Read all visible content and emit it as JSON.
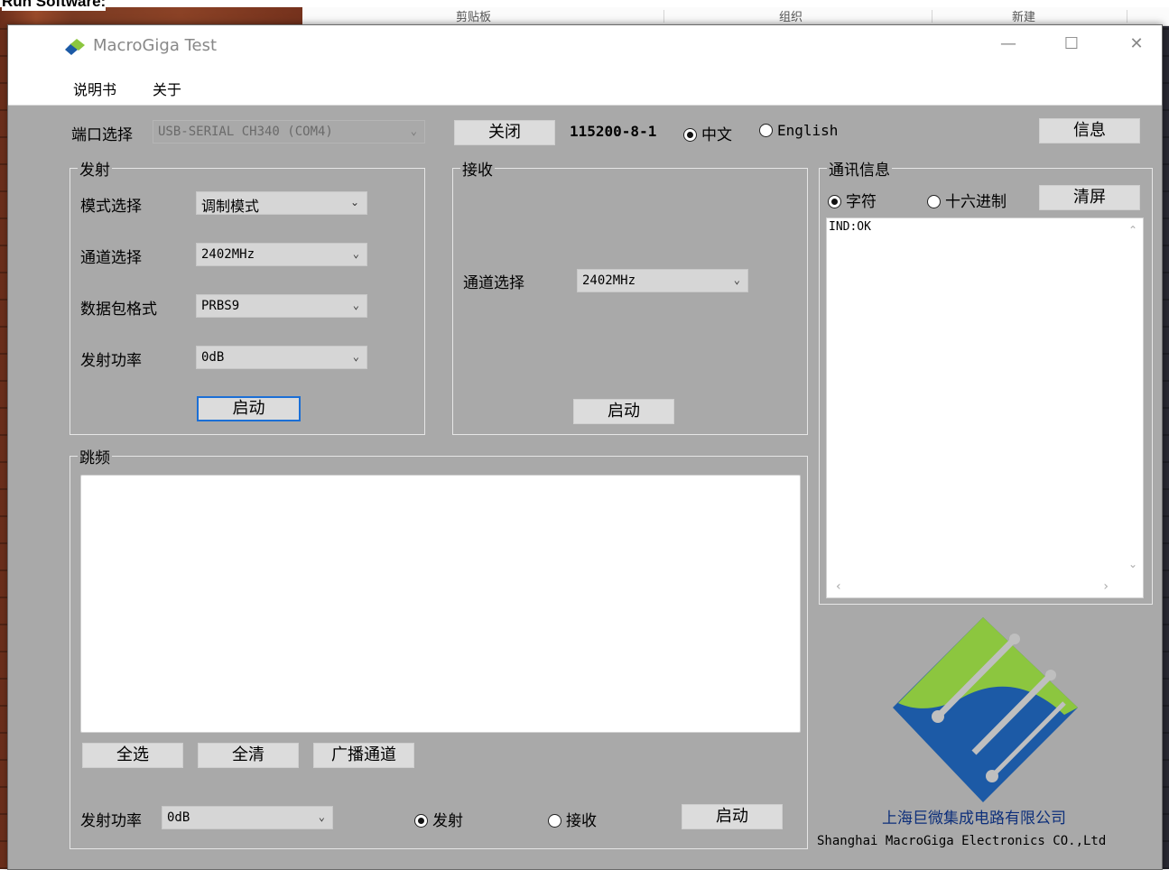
{
  "doc_caption": "Run Software:",
  "ribbon": {
    "clipboard": "剪贴板",
    "organize": "组织",
    "new": "新建"
  },
  "window": {
    "title": "MacroGiga Test",
    "controls": {
      "minimize": "—",
      "maximize": "☐",
      "close": "✕"
    }
  },
  "menu": {
    "manual": "说明书",
    "about": "关于"
  },
  "port": {
    "label": "端口选择",
    "value": "USB-SERIAL CH340 (COM4)",
    "close_button": "关闭",
    "baud": "115200-8-1",
    "lang_cn": "中文",
    "lang_en": "English",
    "info_button": "信息"
  },
  "tx": {
    "title": "发射",
    "mode_label": "模式选择",
    "mode_value": "调制模式",
    "channel_label": "通道选择",
    "channel_value": "2402MHz",
    "format_label": "数据包格式",
    "format_value": "PRBS9",
    "power_label": "发射功率",
    "power_value": "0dB",
    "start_button": "启动"
  },
  "rx": {
    "title": "接收",
    "channel_label": "通道选择",
    "channel_value": "2402MHz",
    "start_button": "启动"
  },
  "comm": {
    "title": "通讯信息",
    "char_mode": "字符",
    "hex_mode": "十六进制",
    "clear_button": "清屏",
    "log_text": "IND:OK"
  },
  "hop": {
    "title": "跳频",
    "select_all": "全选",
    "clear_all": "全清",
    "broadcast": "广播通道",
    "power_label": "发射功率",
    "power_value": "0dB",
    "tx_radio": "发射",
    "rx_radio": "接收",
    "start_button": "启动"
  },
  "company": {
    "name_cn": "上海巨微集成电路有限公司",
    "name_en": "Shanghai MacroGiga Electronics CO.,Ltd",
    "colors": {
      "green": "#8cc63f",
      "blue": "#1c5aa6"
    }
  }
}
